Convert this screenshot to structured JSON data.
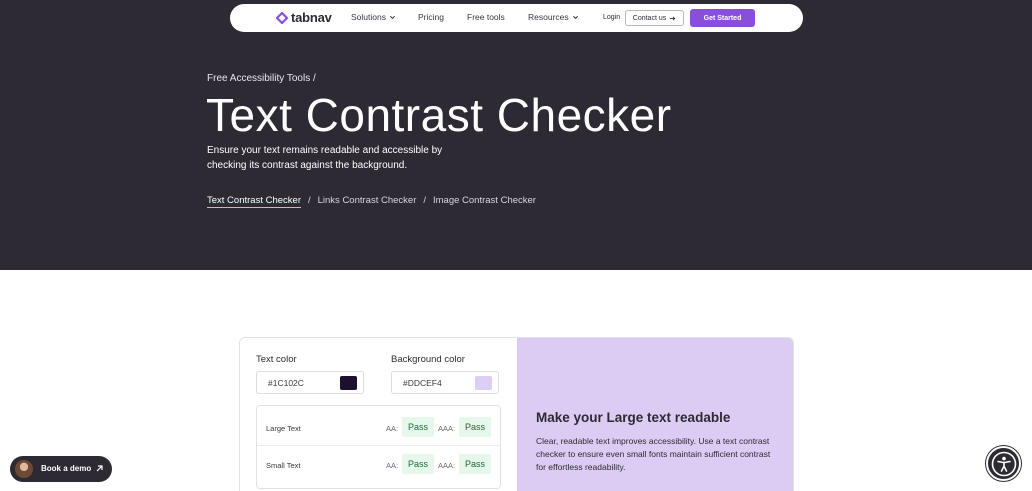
{
  "nav": {
    "brand": "tabnav",
    "items": [
      {
        "label": "Solutions",
        "dropdown": true
      },
      {
        "label": "Pricing",
        "dropdown": false
      },
      {
        "label": "Free tools",
        "dropdown": false
      },
      {
        "label": "Resources",
        "dropdown": true
      }
    ],
    "login": "Login",
    "contact": "Contact us",
    "get_started": "Get Started"
  },
  "hero": {
    "breadcrumb": "Free Accessibility Tools /",
    "title": "Text Contrast Checker",
    "description": "Ensure your text remains readable and accessible by checking its contrast against the background.",
    "tabs": [
      "Text Contrast Checker",
      "Links Contrast Checker",
      "Image Contrast Checker"
    ],
    "separator": "/"
  },
  "checker": {
    "text_color_label": "Text color",
    "text_color_value": "#1C102C",
    "background_color_label": "Background color",
    "background_color_value": "#DDCEF4",
    "results": [
      {
        "label": "Large Text",
        "aa_label": "AA:",
        "aa": "Pass",
        "aaa_label": "AAA:",
        "aaa": "Pass"
      },
      {
        "label": "Small Text",
        "aa_label": "AA:",
        "aa": "Pass",
        "aaa_label": "AAA:",
        "aaa": "Pass"
      }
    ]
  },
  "promo": {
    "title": "Make your Large text readable",
    "text": "Clear, readable text improves accessibility. Use a text contrast checker to ensure even small fonts maintain sufficient contrast for effortless readability."
  },
  "widgets": {
    "book_demo": "Book a demo"
  },
  "colors": {
    "hero_bg": "#2d2a33",
    "accent": "#8a4fd8",
    "promo_bg": "#dcccf3",
    "pass_bg": "#e6f7ec",
    "tab_underline": "#7fe3b0"
  },
  "icons": [
    "tabnav-logo-icon",
    "chevron-down-icon",
    "arrow-right-icon",
    "arrow-up-right-icon",
    "accessibility-icon",
    "avatar"
  ]
}
